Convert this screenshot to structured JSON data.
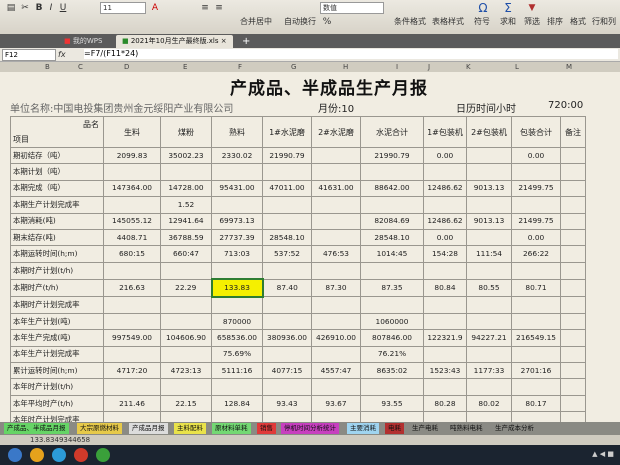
{
  "ribbon": {
    "font_size": "11",
    "number_format": "数值",
    "merge_label": "合并居中",
    "wrap_label": "自动换行",
    "cond_format": "条件格式",
    "table_style": "表格样式",
    "symbol": "符号",
    "sum": "求和",
    "filter": "筛选",
    "sort": "排序",
    "format": "格式",
    "rows_cols": "行和列"
  },
  "tabs": [
    {
      "label": "我的WPS"
    },
    {
      "label": "2021年10月生产最终版.xls"
    }
  ],
  "formula_bar": {
    "cell": "F12",
    "formula": "=F7/(F11*24)"
  },
  "columns": [
    "B",
    "C",
    "D",
    "E",
    "F",
    "G",
    "H",
    "I",
    "J",
    "K",
    "L",
    "M"
  ],
  "report": {
    "title": "产成品、半成品生产月报",
    "unit": "单位名称:中国电投集团贵州金元绥阳产业有限公司",
    "month": "月份:10",
    "calendar_label": "日历时间小时",
    "calendar_value": "720:00",
    "header_item": "项目",
    "header_product": "品名",
    "col_headers": [
      "生料",
      "煤粉",
      "熟料",
      "1#水泥磨",
      "2#水泥磨",
      "水泥合计",
      "1#包装机",
      "2#包装机",
      "包装合计",
      "备注"
    ],
    "rows": [
      {
        "label": "期初结存（吨）",
        "cells": [
          "2099.83",
          "35002.23",
          "2330.02",
          "21990.79",
          "",
          "21990.79",
          "0.00",
          "",
          "0.00",
          ""
        ]
      },
      {
        "label": "本期计划（吨）",
        "cells": [
          "",
          "",
          "",
          "",
          "",
          "",
          "",
          "",
          "",
          ""
        ]
      },
      {
        "label": "本期完成（吨）",
        "cells": [
          "147364.00",
          "14728.00",
          "95431.00",
          "47011.00",
          "41631.00",
          "88642.00",
          "12486.62",
          "9013.13",
          "21499.75",
          ""
        ]
      },
      {
        "label": "本期生产计划完成率",
        "cells": [
          "",
          "1.52",
          "",
          "",
          "",
          "",
          "",
          "",
          "",
          ""
        ]
      },
      {
        "label": "本期消耗(吨)",
        "cells": [
          "145055.12",
          "12941.64",
          "69973.13",
          "",
          "",
          "82084.69",
          "12486.62",
          "9013.13",
          "21499.75",
          ""
        ]
      },
      {
        "label": "期末结存(吨)",
        "cells": [
          "4408.71",
          "36788.59",
          "27737.39",
          "28548.10",
          "",
          "28548.10",
          "0.00",
          "",
          "0.00",
          ""
        ]
      },
      {
        "label": "本期运转时间(h;m)",
        "cells": [
          "680:15",
          "660:47",
          "713:03",
          "537:52",
          "476:53",
          "1014:45",
          "154:28",
          "111:54",
          "266:22",
          ""
        ]
      },
      {
        "label": "本期时产计划(t/h)",
        "cells": [
          "",
          "",
          "",
          "",
          "",
          "",
          "",
          "",
          "",
          ""
        ]
      },
      {
        "label": "本期时产(t/h)",
        "cells": [
          "216.63",
          "22.29",
          "133.83",
          "87.40",
          "87.30",
          "87.35",
          "80.84",
          "80.55",
          "80.71",
          ""
        ]
      },
      {
        "label": "本期时产计划完成率",
        "cells": [
          "",
          "",
          "",
          "",
          "",
          "",
          "",
          "",
          "",
          ""
        ]
      },
      {
        "label": "本年生产计划(吨)",
        "cells": [
          "",
          "",
          "870000",
          "",
          "",
          "1060000",
          "",
          "",
          "",
          ""
        ]
      },
      {
        "label": "本年生产完成(吨)",
        "cells": [
          "997549.00",
          "104606.90",
          "658536.00",
          "380936.00",
          "426910.00",
          "807846.00",
          "122321.9",
          "94227.21",
          "216549.15",
          ""
        ]
      },
      {
        "label": "本年生产计划完成率",
        "cells": [
          "",
          "",
          "75.69%",
          "",
          "",
          "76.21%",
          "",
          "",
          "",
          ""
        ]
      },
      {
        "label": "累计运转时间(h;m)",
        "cells": [
          "4717:20",
          "4723:13",
          "5111:16",
          "4077:15",
          "4557:47",
          "8635:02",
          "1523:43",
          "1177:33",
          "2701:16",
          ""
        ]
      },
      {
        "label": "本年时产计划(t/h)",
        "cells": [
          "",
          "",
          "",
          "",
          "",
          "",
          "",
          "",
          "",
          ""
        ]
      },
      {
        "label": "本年平均时产(t/h)",
        "cells": [
          "211.46",
          "22.15",
          "128.84",
          "93.43",
          "93.67",
          "93.55",
          "80.28",
          "80.02",
          "80.17",
          ""
        ]
      },
      {
        "label": "本年时产计划完成率",
        "cells": [
          "",
          "",
          "",
          "",
          "",
          "",
          "",
          "",
          "",
          ""
        ]
      }
    ]
  },
  "sheet_tabs": [
    {
      "label": "产成品、半成品月报",
      "color": "#66d466"
    },
    {
      "label": "大宗原燃材料",
      "color": "#e6c94a"
    },
    {
      "label": "产成品月报",
      "color": "#dcdcdc"
    },
    {
      "label": "主料配料",
      "color": "#e9e24a"
    },
    {
      "label": "原材料单耗",
      "color": "#73d873"
    },
    {
      "label": "销售",
      "color": "#e03a3a"
    },
    {
      "label": "停机时间分析统计",
      "color": "#c73fbf"
    },
    {
      "label": "主要消耗",
      "color": "#9fd4f0"
    },
    {
      "label": "电耗",
      "color": "#b23030"
    },
    {
      "label": "生产电耗",
      "color": "#8a8a84"
    },
    {
      "label": "吨熟料电耗",
      "color": "#8a8a84"
    },
    {
      "label": "生产成本分析",
      "color": "#8a8a84"
    }
  ],
  "status": {
    "sum": "133.8349344658"
  }
}
